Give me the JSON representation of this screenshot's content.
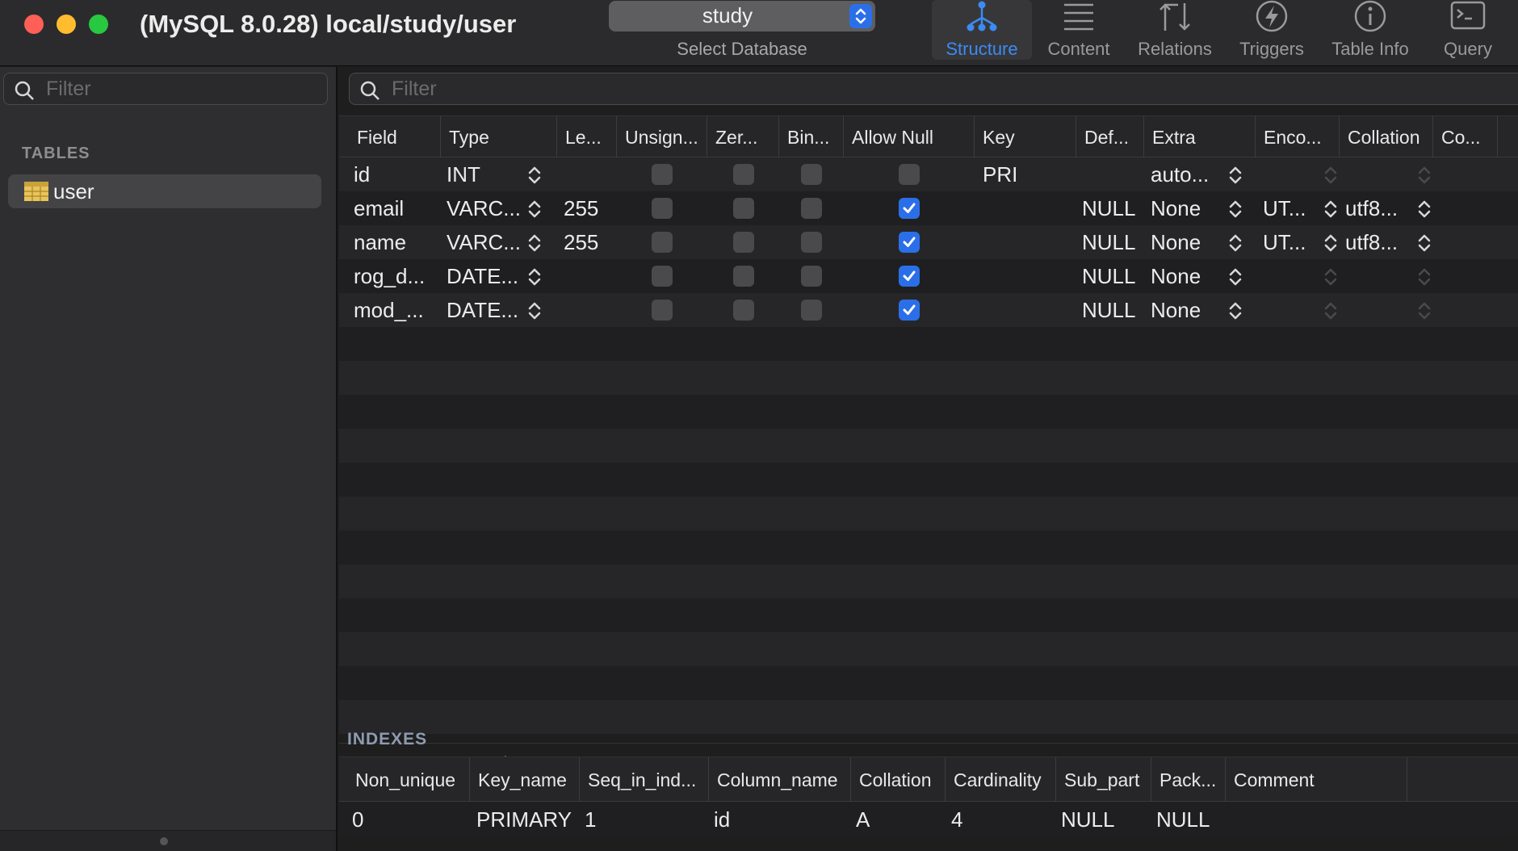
{
  "window": {
    "title": "(MySQL 8.0.28) local/study/user",
    "db_select_value": "study",
    "db_select_caption": "Select Database"
  },
  "toolbar": {
    "tabs": [
      {
        "label": "Structure",
        "icon": "structure-icon",
        "active": true
      },
      {
        "label": "Content",
        "icon": "content-icon",
        "active": false
      },
      {
        "label": "Relations",
        "icon": "relations-icon",
        "active": false
      },
      {
        "label": "Triggers",
        "icon": "triggers-icon",
        "active": false
      },
      {
        "label": "Table Info",
        "icon": "table-info-icon",
        "active": false
      },
      {
        "label": "Query",
        "icon": "query-icon",
        "active": false
      }
    ]
  },
  "sidebar": {
    "filter_placeholder": "Filter",
    "heading": "TABLES",
    "tables": [
      {
        "name": "user",
        "icon": "table-icon"
      }
    ]
  },
  "structure": {
    "filter_placeholder": "Filter",
    "columns": [
      "Field",
      "Type",
      "Le...",
      "Unsign...",
      "Zer...",
      "Bin...",
      "Allow Null",
      "Key",
      "Def...",
      "Extra",
      "Enco...",
      "Collation",
      "Co..."
    ],
    "rows": [
      {
        "field": "id",
        "type": "INT",
        "length": "",
        "unsigned": false,
        "zerofill": false,
        "binary": false,
        "allow_null": false,
        "key": "PRI",
        "default": "",
        "extra": "auto...",
        "encoding": "",
        "collation": ""
      },
      {
        "field": "email",
        "type": "VARC...",
        "length": "255",
        "unsigned": false,
        "zerofill": false,
        "binary": false,
        "allow_null": true,
        "key": "",
        "default": "NULL",
        "extra": "None",
        "encoding": "UT...",
        "collation": "utf8..."
      },
      {
        "field": "name",
        "type": "VARC...",
        "length": "255",
        "unsigned": false,
        "zerofill": false,
        "binary": false,
        "allow_null": true,
        "key": "",
        "default": "NULL",
        "extra": "None",
        "encoding": "UT...",
        "collation": "utf8..."
      },
      {
        "field": "rog_d...",
        "type": "DATE...",
        "length": "",
        "unsigned": false,
        "zerofill": false,
        "binary": false,
        "allow_null": true,
        "key": "",
        "default": "NULL",
        "extra": "None",
        "encoding": "",
        "collation": ""
      },
      {
        "field": "mod_...",
        "type": "DATE...",
        "length": "",
        "unsigned": false,
        "zerofill": false,
        "binary": false,
        "allow_null": true,
        "key": "",
        "default": "NULL",
        "extra": "None",
        "encoding": "",
        "collation": ""
      }
    ]
  },
  "indexes": {
    "heading": "INDEXES",
    "columns": [
      "Non_unique",
      "Key_name",
      "Seq_in_ind...",
      "Column_name",
      "Collation",
      "Cardinality",
      "Sub_part",
      "Pack...",
      "Comment"
    ],
    "rows": [
      [
        "0",
        "PRIMARY",
        "1",
        "id",
        "A",
        "4",
        "NULL",
        "NULL",
        ""
      ]
    ]
  },
  "colors": {
    "accent": "#2b6fe8",
    "active_tab": "#3b8bf5"
  }
}
